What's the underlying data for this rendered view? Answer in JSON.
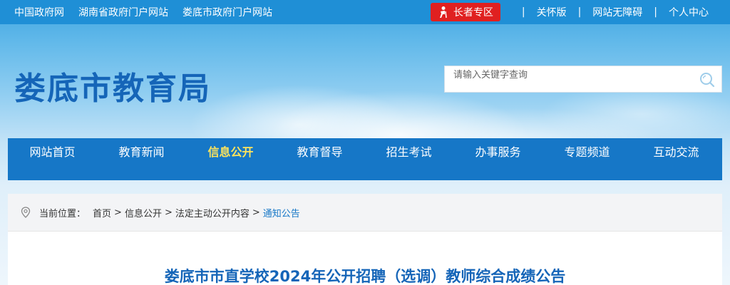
{
  "topbar": {
    "links": [
      "中国政府网",
      "湖南省政府门户网站",
      "娄底市政府门户网站"
    ],
    "elder_label": "长者专区",
    "right_links": [
      "关怀版",
      "网站无障碍",
      "个人中心"
    ],
    "separator": "|"
  },
  "header": {
    "site_title": "娄底市教育局",
    "search_placeholder": "请输入关键字查询"
  },
  "nav": {
    "items": [
      {
        "label": "网站首页",
        "active": false
      },
      {
        "label": "教育新闻",
        "active": false
      },
      {
        "label": "信息公开",
        "active": true
      },
      {
        "label": "教育督导",
        "active": false
      },
      {
        "label": "招生考试",
        "active": false
      },
      {
        "label": "办事服务",
        "active": false
      },
      {
        "label": "专题频道",
        "active": false
      },
      {
        "label": "互动交流",
        "active": false
      }
    ]
  },
  "breadcrumb": {
    "label": "当前位置：",
    "items": [
      "首页",
      "信息公开",
      "法定主动公开内容",
      "通知公告"
    ],
    "arrow": ">"
  },
  "article": {
    "title": "娄底市市直学校2024年公开招聘（选调）教师综合成绩公告"
  },
  "colors": {
    "topbar": "#1f8fd6",
    "nav": "#1677c7",
    "nav_active": "#ffe45c",
    "title": "#1565b8",
    "elder": "#e02020"
  }
}
